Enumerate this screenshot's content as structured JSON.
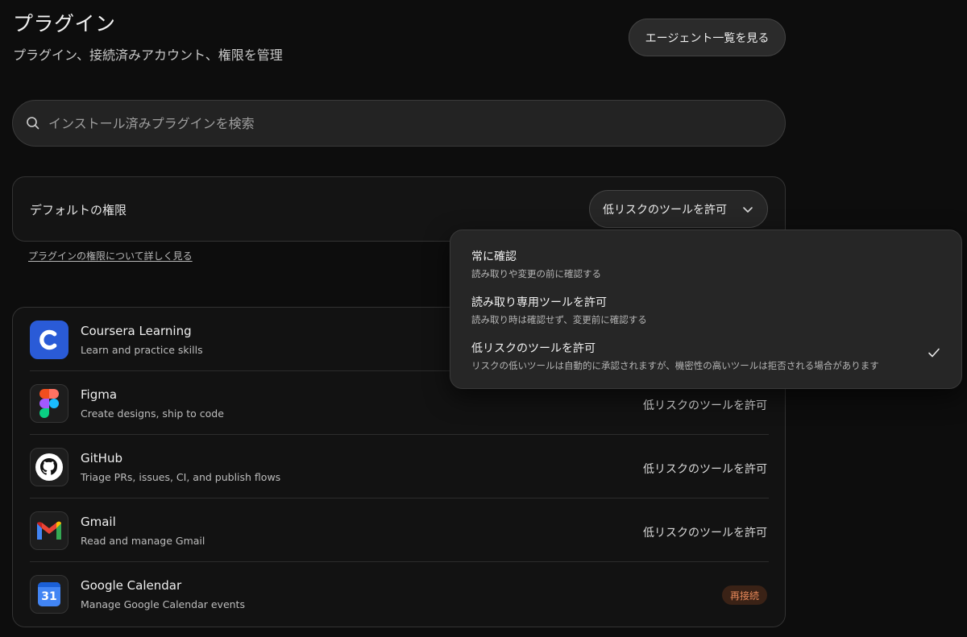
{
  "header": {
    "title": "プラグイン",
    "subtitle": "プラグイン、接続済みアカウント、権限を管理",
    "agents_button": "エージェント一覧を見る"
  },
  "search": {
    "placeholder": "インストール済みプラグインを検索",
    "value": "",
    "icon": "search-icon"
  },
  "default_permission": {
    "label": "デフォルトの権限",
    "selected": "低リスクのツールを許可",
    "learn_more": "プラグインの権限について詳しく見る"
  },
  "dropdown": {
    "options": [
      {
        "title": "常に確認",
        "desc": "読み取りや変更の前に確認する",
        "checked": false
      },
      {
        "title": "読み取り専用ツールを許可",
        "desc": "読み取り時は確認せず、変更前に確認する",
        "checked": false
      },
      {
        "title": "低リスクのツールを許可",
        "desc": "リスクの低いツールは自動的に承認されますが、機密性の高いツールは拒否される場合があります",
        "checked": true
      }
    ]
  },
  "plugins": [
    {
      "name": "Coursera Learning",
      "desc": "Learn and practice skills",
      "status": "",
      "icon": "coursera-icon"
    },
    {
      "name": "Figma",
      "desc": "Create designs, ship to code",
      "status": "低リスクのツールを許可",
      "icon": "figma-icon"
    },
    {
      "name": "GitHub",
      "desc": "Triage PRs, issues, CI, and publish flows",
      "status": "低リスクのツールを許可",
      "icon": "github-icon"
    },
    {
      "name": "Gmail",
      "desc": "Read and manage Gmail",
      "status": "低リスクのツールを許可",
      "icon": "gmail-icon"
    },
    {
      "name": "Google Calendar",
      "desc": "Manage Google Calendar events",
      "status": "再接続",
      "icon": "google-calendar-icon",
      "calendar_day": "31"
    }
  ],
  "colors": {
    "background": "#0d0d0d",
    "accent_reconnect": "#e8895a",
    "coursera_blue": "#2a5bd7"
  }
}
